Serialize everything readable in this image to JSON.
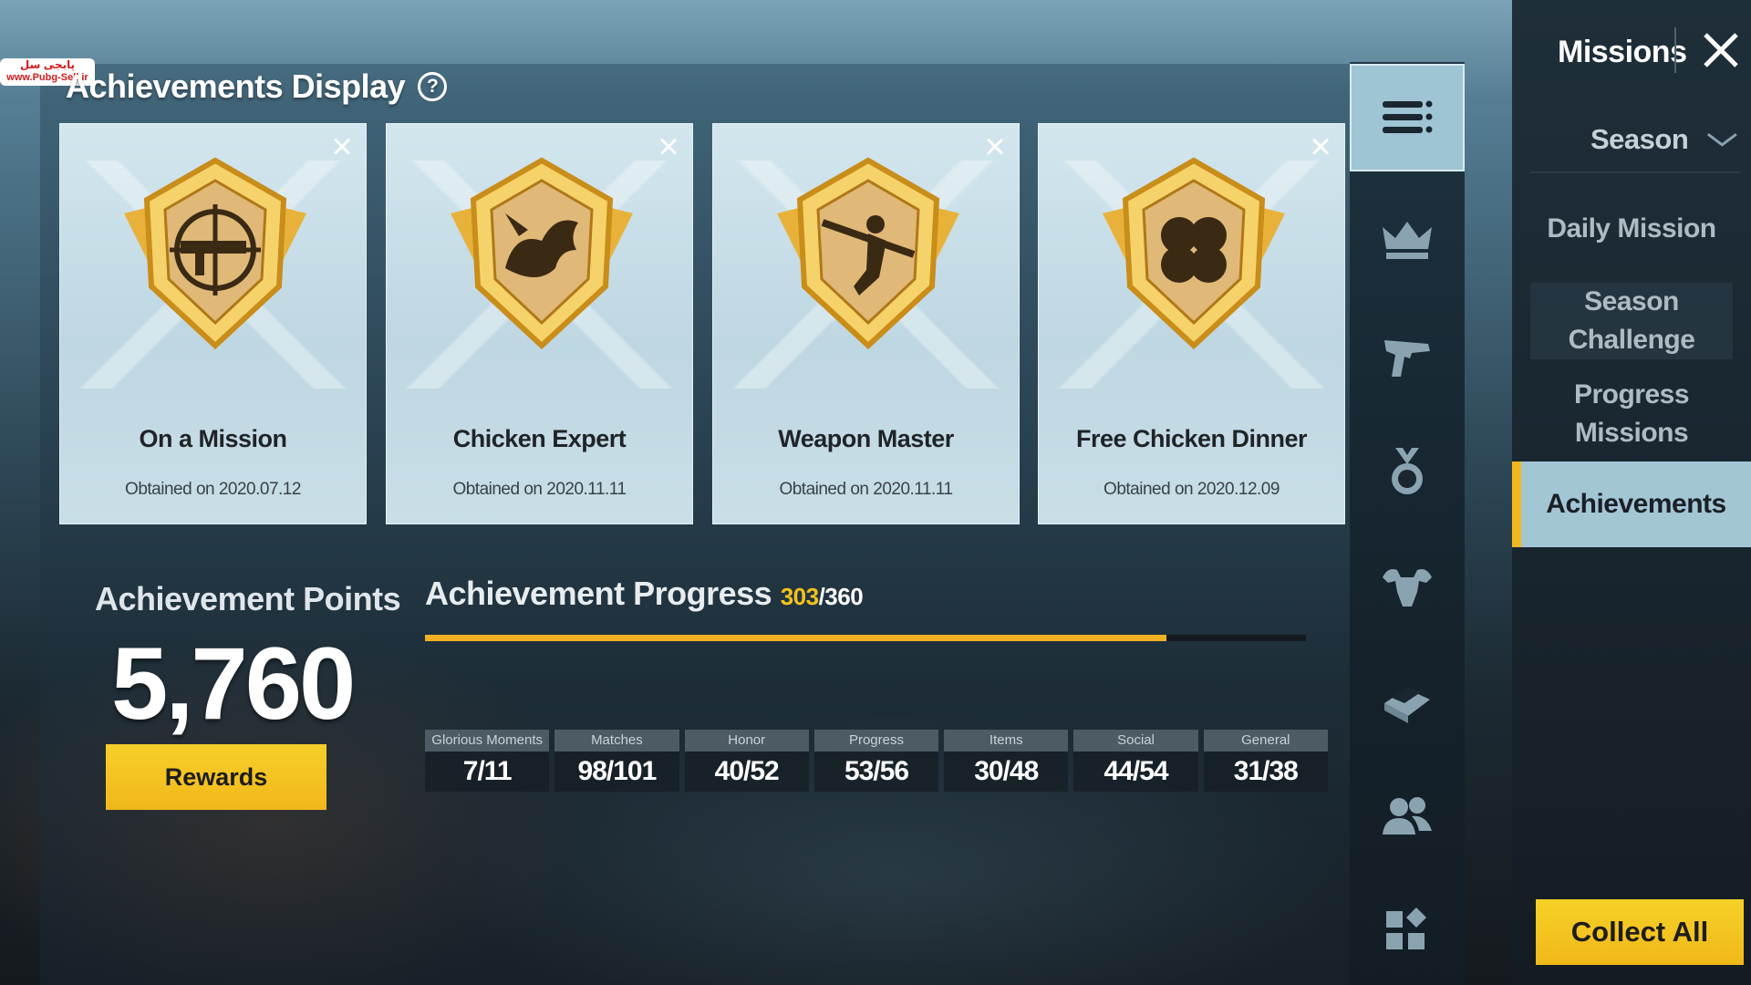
{
  "watermark": {
    "line1": "پابجی سل",
    "line2": "www.Pubg-Sell.ir"
  },
  "display": {
    "title": "Achievements Display",
    "help": "?"
  },
  "cards": [
    {
      "name": "On a Mission",
      "date": "Obtained on 2020.07.12",
      "emblem": "crosshair-rifle-icon"
    },
    {
      "name": "Chicken Expert",
      "date": "Obtained on 2020.11.11",
      "emblem": "chicken-icon"
    },
    {
      "name": "Weapon Master",
      "date": "Obtained on 2020.11.11",
      "emblem": "soldier-rifle-icon"
    },
    {
      "name": "Free Chicken Dinner",
      "date": "Obtained on 2020.12.09",
      "emblem": "four-leaf-clover-icon"
    }
  ],
  "points": {
    "label": "Achievement Points",
    "value": "5,760",
    "rewards": "Rewards"
  },
  "progress": {
    "label": "Achievement Progress",
    "current": "303",
    "total": "/360",
    "fraction": 0.8417
  },
  "stats": [
    {
      "label": "Glorious Moments",
      "value": "7/11"
    },
    {
      "label": "Matches",
      "value": "98/101"
    },
    {
      "label": "Honor",
      "value": "40/52"
    },
    {
      "label": "Progress",
      "value": "53/56"
    },
    {
      "label": "Items",
      "value": "30/48"
    },
    {
      "label": "Social",
      "value": "44/54"
    },
    {
      "label": "General",
      "value": "31/38"
    }
  ],
  "categories": [
    "list-icon",
    "crown-icon",
    "pistol-icon",
    "medal-icon",
    "muscle-icon",
    "crate-icon",
    "friends-icon",
    "grid-icon"
  ],
  "side": {
    "title": "Missions",
    "season": "Season",
    "items": [
      {
        "label": "Daily Mission"
      },
      {
        "label": "Season Challenge"
      },
      {
        "label": "Progress Missions"
      },
      {
        "label": "Achievements"
      }
    ],
    "collect": "Collect All"
  },
  "colors": {
    "accent": "#f3b023",
    "gold": "#f3c21c",
    "active_tab": "#a3c6d5"
  }
}
